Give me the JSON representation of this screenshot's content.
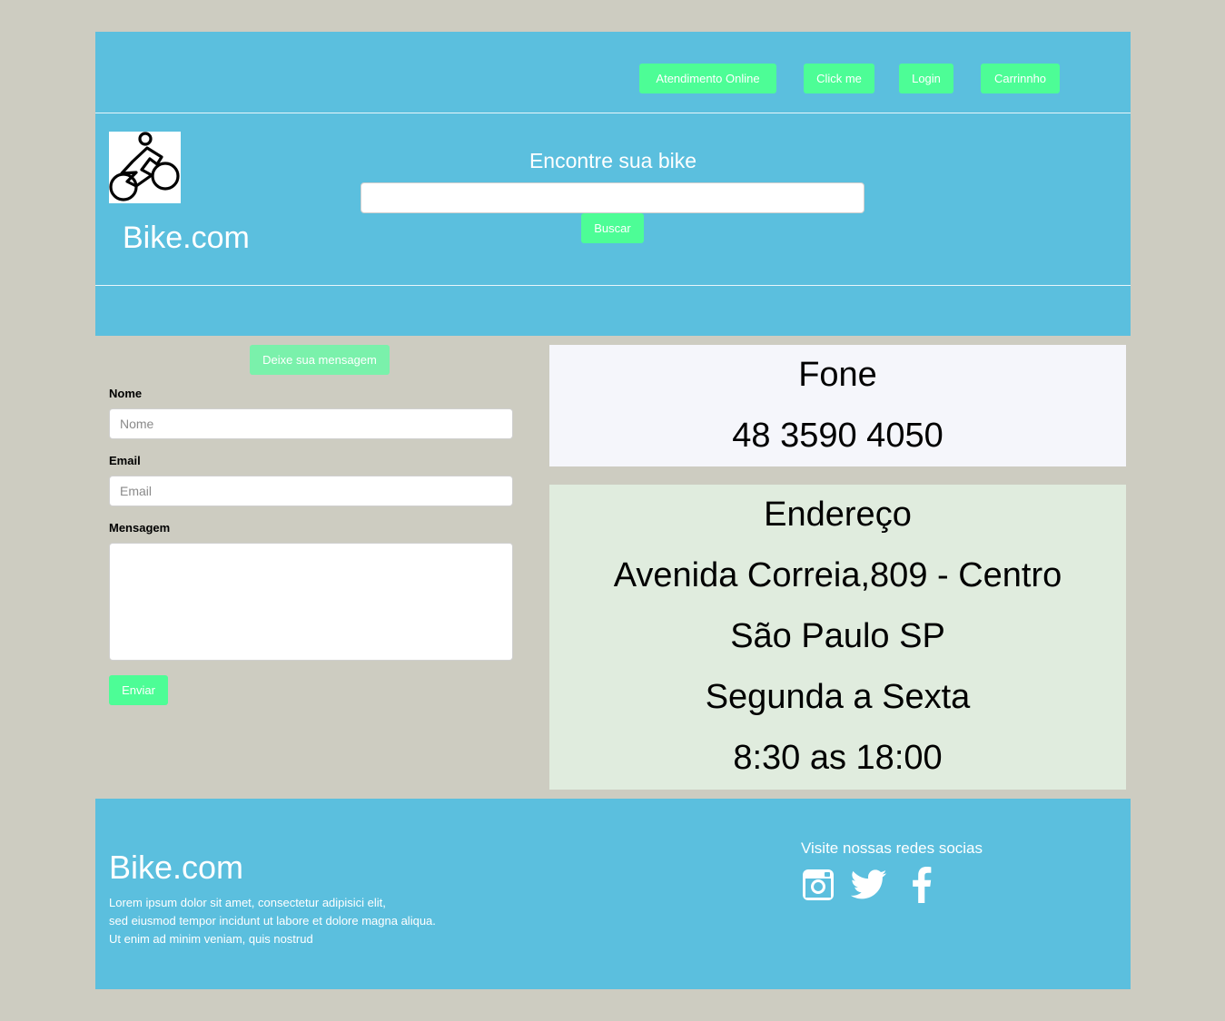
{
  "nav": {
    "buttons": [
      {
        "label": "Atendimento Online"
      },
      {
        "label": "Click me"
      },
      {
        "label": "Login"
      },
      {
        "label": "Carrinnho"
      }
    ]
  },
  "header": {
    "brand": "Bike.com",
    "logo_icon": "bicycle-rider-icon",
    "search_title": "Encontre sua bike",
    "search_value": "",
    "search_button": "Buscar"
  },
  "form": {
    "title_button": "Deixe sua mensagem",
    "name_label": "Nome",
    "name_placeholder": "Nome",
    "email_label": "Email",
    "email_placeholder": "Email",
    "message_label": "Mensagem",
    "submit_label": "Enviar"
  },
  "contact": {
    "phone_title": "Fone",
    "phone_number": "48 3590 4050",
    "address_title": "Endereço",
    "address_line1": "Avenida Correia,809 - Centro",
    "address_line2": "São Paulo SP",
    "hours_days": "Segunda a Sexta",
    "hours_time": "8:30 as 18:00"
  },
  "footer": {
    "brand": "Bike.com",
    "text_lines": [
      "Lorem ipsum dolor sit amet, consectetur adipisici elit,",
      "sed eiusmod tempor incidunt ut labore et dolore magna aliqua.",
      "Ut enim ad minim veniam, quis nostrud"
    ],
    "social_title": "Visite nossas redes socias",
    "social_icons": [
      "instagram-icon",
      "twitter-icon",
      "facebook-icon"
    ]
  },
  "colors": {
    "page_background": "#cdccc1",
    "header_blue": "#5bbfde",
    "button_green": "#4dfd96",
    "phone_panel": "#f5f6fb",
    "address_panel": "#e0ecde"
  }
}
